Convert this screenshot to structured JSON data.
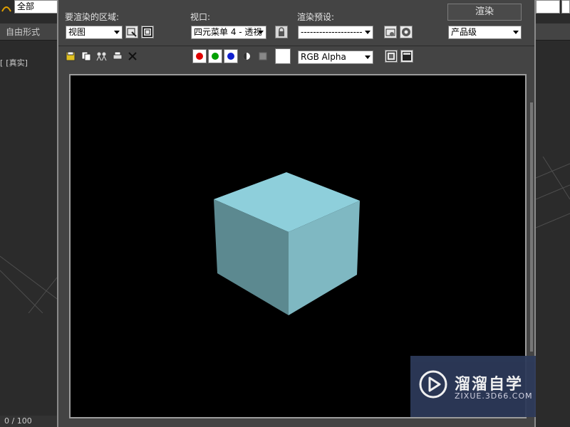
{
  "background_app": {
    "selection_combo": "全部",
    "tab_label": "自由形式",
    "viewport_label": "[真实]",
    "status": "0 / 100"
  },
  "dialog": {
    "area_label": "要渲染的区域:",
    "area_value": "视图",
    "viewport_label": "视口:",
    "viewport_value": "四元菜单 4 - 透视",
    "preset_label": "渲染预设:",
    "preset_value": "--------------------",
    "render_button": "渲染",
    "quality_value": "产品级",
    "channel_value": "RGB Alpha"
  },
  "render": {
    "cube_color": "#8ecfdb",
    "background": "#000000"
  },
  "watermark": {
    "brand": "溜溜自学",
    "url": "ZIXUE.3D66.COM"
  },
  "colors": {
    "red_channel": "#e00000",
    "green_channel": "#00a000",
    "blue_channel": "#1020d0"
  }
}
